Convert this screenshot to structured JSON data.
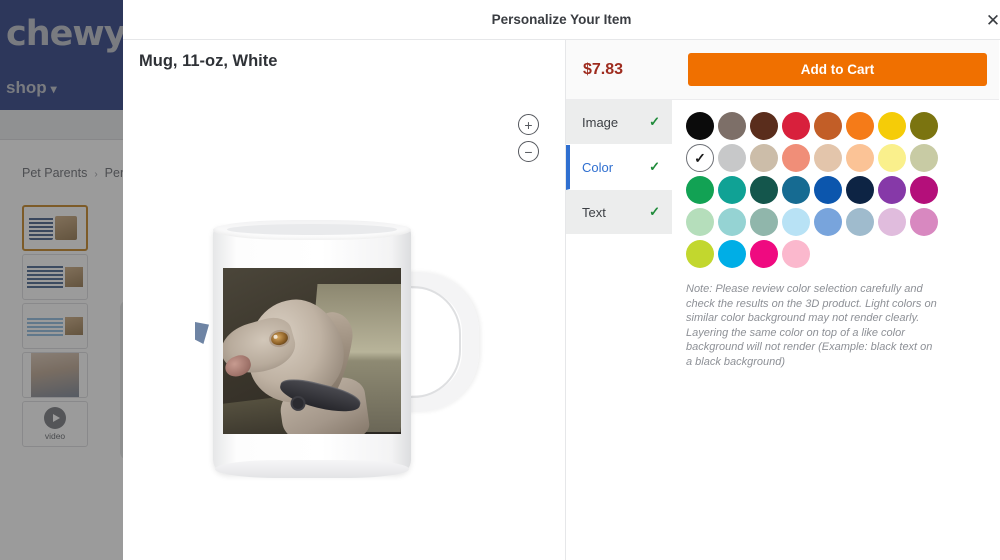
{
  "background": {
    "brand_logo": "chewy",
    "shop_label": "shop",
    "shop_chevron_icon": "chevron-down-icon",
    "breadcrumb": {
      "items": [
        "Pet Parents",
        "Pers"
      ],
      "separator": "›"
    },
    "thumbnails": [
      {
        "name": "thumbnail-mug-pair",
        "selected": true
      },
      {
        "name": "thumbnail-mug-flat",
        "selected": false
      },
      {
        "name": "thumbnail-mug-pattern",
        "selected": false
      },
      {
        "name": "thumbnail-lifestyle-photo",
        "selected": false
      },
      {
        "name": "thumbnail-video",
        "selected": false,
        "label": "video"
      }
    ]
  },
  "modal": {
    "title": "Personalize Your Item",
    "close_icon": "close-icon",
    "product_title": "Mug, 11-oz, White",
    "zoom_in_icon": "plus-circle-icon",
    "zoom_out_icon": "minus-circle-icon",
    "zoom_in_label": "+",
    "zoom_out_label": "−",
    "price": "$7.83",
    "add_to_cart_label": "Add to Cart",
    "accent_orange": "#f07000",
    "price_color": "#9e2b1e",
    "active_tab_color": "#2f6fd0",
    "check_color": "#1f8b3a",
    "tabs": [
      {
        "label": "Image",
        "checked": true,
        "active": false,
        "check": "✓"
      },
      {
        "label": "Color",
        "checked": true,
        "active": true,
        "check": "✓"
      },
      {
        "label": "Text",
        "checked": true,
        "active": false,
        "check": "✓"
      }
    ],
    "color_swatches": [
      {
        "name": "black",
        "hex": "#0b0b0b",
        "selected": false
      },
      {
        "name": "warm-gray",
        "hex": "#7d6f68",
        "selected": false
      },
      {
        "name": "dark-brown",
        "hex": "#5a2d1c",
        "selected": false
      },
      {
        "name": "crimson",
        "hex": "#d8203c",
        "selected": false
      },
      {
        "name": "sienna",
        "hex": "#c25e27",
        "selected": false
      },
      {
        "name": "orange",
        "hex": "#f57b18",
        "selected": false
      },
      {
        "name": "yellow",
        "hex": "#f5cc08",
        "selected": false
      },
      {
        "name": "olive",
        "hex": "#7b7410",
        "selected": false
      },
      {
        "name": "white",
        "hex": "#ffffff",
        "selected": true
      },
      {
        "name": "light-gray",
        "hex": "#c7c8c9",
        "selected": false
      },
      {
        "name": "tan",
        "hex": "#ccbda9",
        "selected": false
      },
      {
        "name": "salmon",
        "hex": "#f08e78",
        "selected": false
      },
      {
        "name": "beige",
        "hex": "#e3c5ab",
        "selected": false
      },
      {
        "name": "peach",
        "hex": "#fbc396",
        "selected": false
      },
      {
        "name": "light-yellow",
        "hex": "#faf08c",
        "selected": false
      },
      {
        "name": "light-sage",
        "hex": "#c8cba4",
        "selected": false
      },
      {
        "name": "green",
        "hex": "#12a254",
        "selected": false
      },
      {
        "name": "teal",
        "hex": "#10a295",
        "selected": false
      },
      {
        "name": "dark-teal",
        "hex": "#14564c",
        "selected": false
      },
      {
        "name": "steel-blue",
        "hex": "#166b92",
        "selected": false
      },
      {
        "name": "blue",
        "hex": "#0c56ad",
        "selected": false
      },
      {
        "name": "navy",
        "hex": "#0d2444",
        "selected": false
      },
      {
        "name": "purple",
        "hex": "#8639a8",
        "selected": false
      },
      {
        "name": "magenta",
        "hex": "#b40f7a",
        "selected": false
      },
      {
        "name": "light-green",
        "hex": "#b5debb",
        "selected": false
      },
      {
        "name": "light-teal",
        "hex": "#95d3d3",
        "selected": false
      },
      {
        "name": "sage-teal",
        "hex": "#90b6ab",
        "selected": false
      },
      {
        "name": "light-blue",
        "hex": "#b8e2f5",
        "selected": false
      },
      {
        "name": "cornflower",
        "hex": "#78a4dc",
        "selected": false
      },
      {
        "name": "gray-blue",
        "hex": "#9fbbcd",
        "selected": false
      },
      {
        "name": "lavender-pink",
        "hex": "#e0bcdd",
        "selected": false
      },
      {
        "name": "pink",
        "hex": "#d888c0",
        "selected": false
      },
      {
        "name": "lime",
        "hex": "#c2d72e",
        "selected": false
      },
      {
        "name": "cyan",
        "hex": "#00aee6",
        "selected": false
      },
      {
        "name": "hot-pink",
        "hex": "#ef0a80",
        "selected": false
      },
      {
        "name": "light-pink",
        "hex": "#fbb8cd",
        "selected": false
      }
    ],
    "note": "Note: Please review color selection carefully and check the results on the 3D product. Light colors on similar color background may not render clearly. Layering the same color on top of a like color background will not render (Example: black text on a black background)"
  }
}
